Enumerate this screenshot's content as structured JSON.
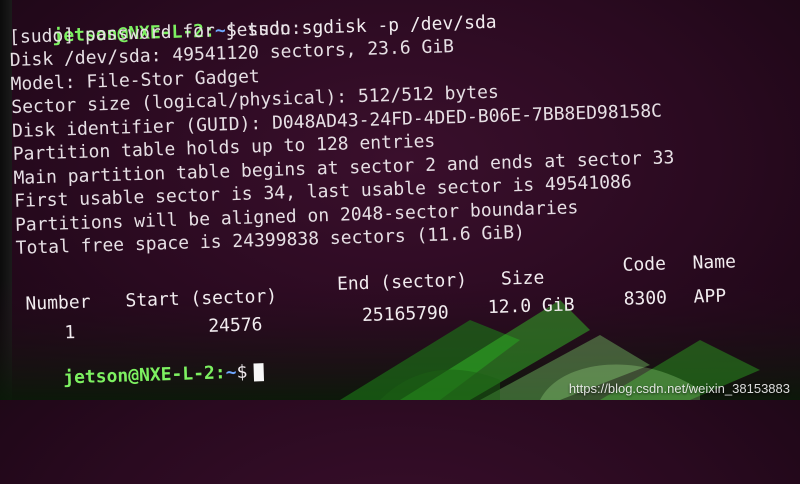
{
  "terminal": {
    "prompt_user": "jetson@NXE-L-2:",
    "prompt_path": "~",
    "prompt_symbol": "$",
    "command": " sudo sgdisk -p /dev/sda",
    "output_lines": [
      "[sudo] password for jetson:",
      "Disk /dev/sda: 49541120 sectors, 23.6 GiB",
      "Model: File-Stor Gadget",
      "Sector size (logical/physical): 512/512 bytes",
      "Disk identifier (GUID): D048AD43-24FD-4DED-B06E-7BB8ED98158C",
      "Partition table holds up to 128 entries",
      "Main partition table begins at sector 2 and ends at sector 33",
      "First usable sector is 34, last usable sector is 49541086",
      "Partitions will be aligned on 2048-sector boundaries",
      "Total free space is 24399838 sectors (11.6 GiB)"
    ],
    "table": {
      "headers": {
        "number": "Number",
        "start": "Start (sector)",
        "end": "End (sector)",
        "size": "Size",
        "code": "Code",
        "name": "Name"
      },
      "rows": [
        {
          "number": "1",
          "start": "24576",
          "end": "25165790",
          "size": "12.0 GiB",
          "code": "8300",
          "name": "APP"
        }
      ]
    },
    "final_prompt_user": "jetson@NXE-L-2:",
    "final_prompt_path": "~",
    "final_prompt_symbol": "$"
  },
  "watermark": "https://blog.csdn.net/weixin_38153883",
  "colors": {
    "background": "#2a0a20",
    "prompt_user": "#7df161",
    "prompt_path": "#6fa8ff",
    "text": "#f1ecef"
  }
}
